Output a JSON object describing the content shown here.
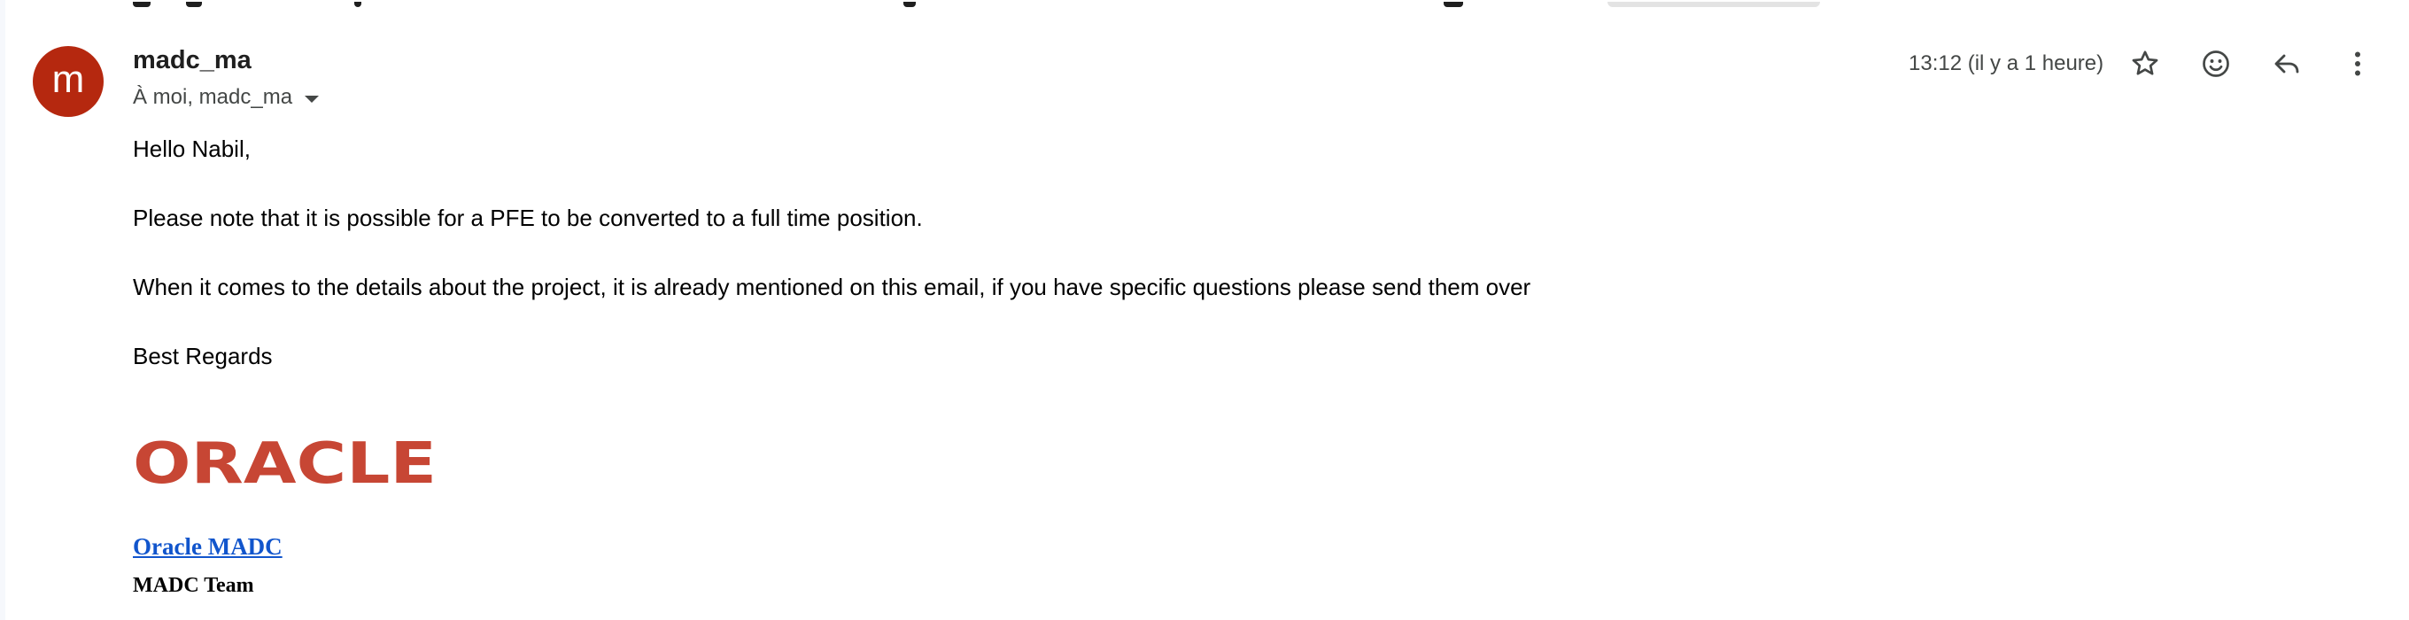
{
  "message": {
    "avatar_letter": "m",
    "avatar_color": "#b5280f",
    "sender": "madc_ma",
    "recipients": "À moi, madc_ma",
    "timestamp": "13:12 (il y a 1 heure)"
  },
  "actions": {
    "star_icon": "star-outline",
    "emoji_icon": "smiley-face",
    "reply_icon": "reply-arrow",
    "more_icon": "vertical-dots"
  },
  "body": {
    "greeting": "Hello Nabil,",
    "paragraph1": "Please note that it is possible for a PFE to be converted to a full time position.",
    "paragraph2": "When it comes to the details about the project, it is already mentioned on this email, if you have specific questions please send them over",
    "closing": "Best Regards"
  },
  "signature": {
    "logo_text": "ORACLE",
    "logo_color": "#c74634",
    "link_text": "Oracle MADC",
    "team": "MADC Team",
    "link_color": "#1155cc"
  }
}
